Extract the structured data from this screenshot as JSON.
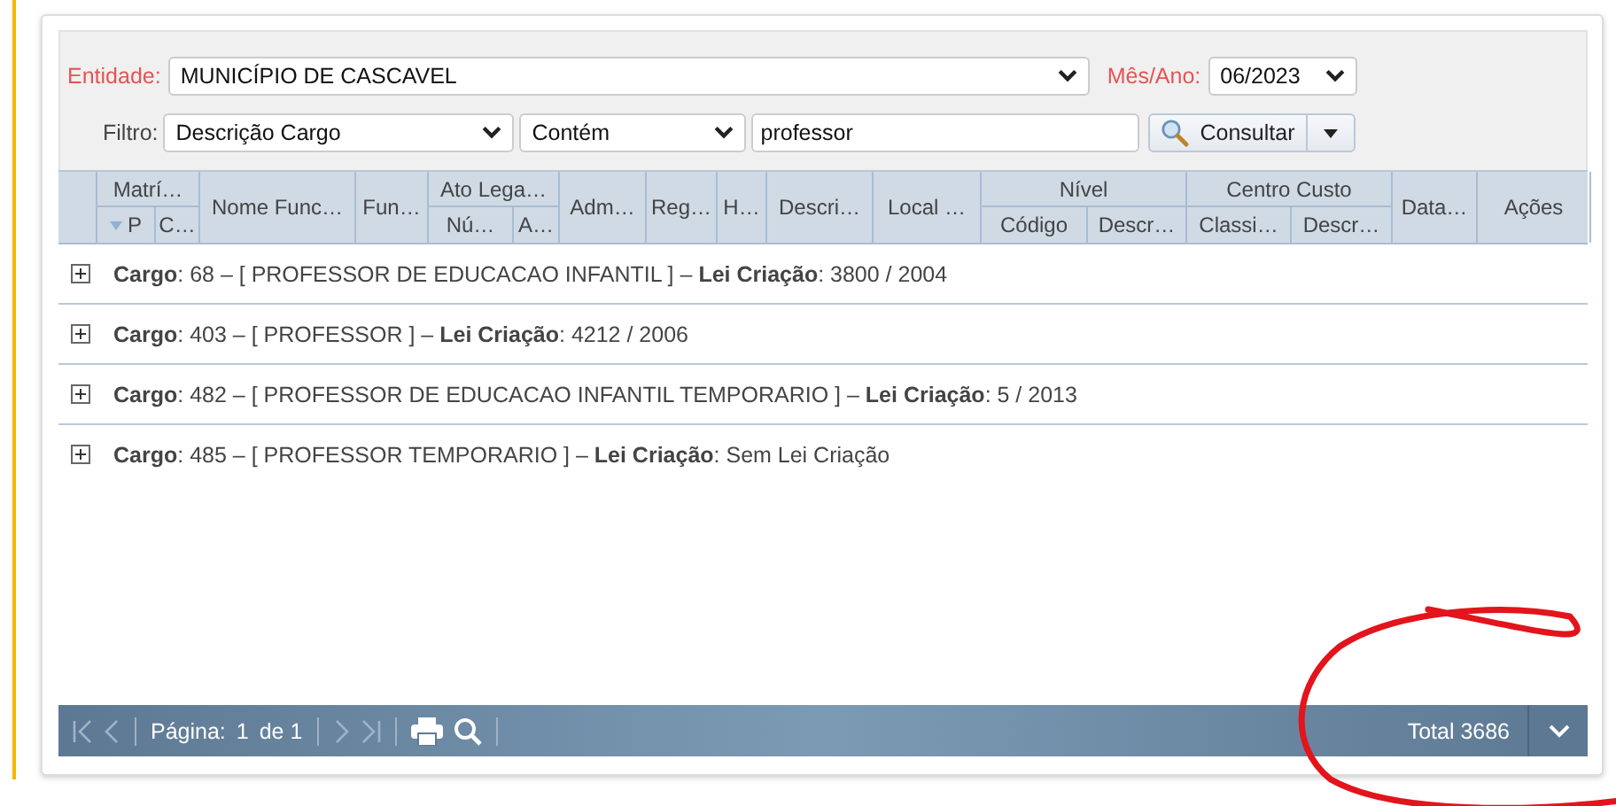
{
  "filters": {
    "entidade": {
      "label": "Entidade:",
      "value": "MUNICÍPIO DE CASCAVEL"
    },
    "mes_ano": {
      "label": "Mês/Ano:",
      "value": "06/2023"
    },
    "filtro": {
      "label": "Filtro:",
      "field": "Descrição Cargo",
      "operator": "Contém",
      "value": "professor"
    },
    "search_button": {
      "label": "Consultar"
    }
  },
  "table": {
    "columns": [
      {
        "label": "Matrí…",
        "children": [
          {
            "label": "P",
            "sorted": true
          },
          {
            "label": "C…",
            "sorted": false
          }
        ]
      },
      {
        "label": "Nome Func…"
      },
      {
        "label": "Fun…"
      },
      {
        "label": "Ato Lega…",
        "children": [
          {
            "label": "Nú…",
            "sorted": false
          },
          {
            "label": "A…",
            "sorted": false
          }
        ]
      },
      {
        "label": "Adm…"
      },
      {
        "label": "Reg…"
      },
      {
        "label": "H…"
      },
      {
        "label": "Descri…"
      },
      {
        "label": "Local …"
      },
      {
        "label": "Nível",
        "children": [
          {
            "label": "Código",
            "sorted": false
          },
          {
            "label": "Descr…",
            "sorted": false
          }
        ]
      },
      {
        "label": "Centro Custo",
        "children": [
          {
            "label": "Classi…",
            "sorted": false
          },
          {
            "label": "Descr…",
            "sorted": false
          }
        ]
      },
      {
        "label": "Data…"
      },
      {
        "label": "Ações"
      }
    ],
    "groups": [
      {
        "text": "**Cargo**: 68 – [ PROFESSOR DE EDUCACAO INFANTIL ] – **Lei Criação**: 3800 / 2004",
        "expanded": false
      },
      {
        "text": "**Cargo**: 403 – [ PROFESSOR ] – **Lei Criação**: 4212 / 2006",
        "expanded": false
      },
      {
        "text": "**Cargo**: 482 – [ PROFESSOR DE EDUCACAO INFANTIL TEMPORARIO ] – **Lei Criação**: 5 / 2013",
        "expanded": false
      },
      {
        "text": "**Cargo**: 485 – [ PROFESSOR TEMPORARIO ] – **Lei Criação**: Sem Lei Criação",
        "expanded": false
      }
    ]
  },
  "pager": {
    "page_label": "Página:",
    "page": "1",
    "of": "de 1",
    "prev_disabled": true,
    "next_disabled": true,
    "total": "Total 3686"
  }
}
